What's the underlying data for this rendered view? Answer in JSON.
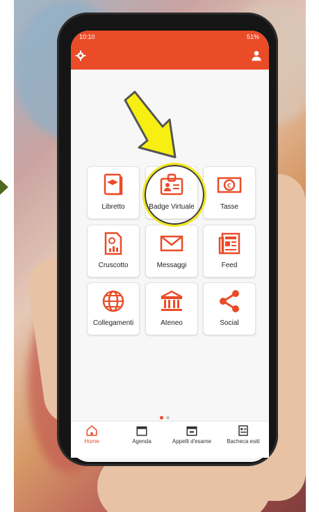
{
  "colors": {
    "accent": "#ea4c28",
    "highlight_ring": "#f2e51b",
    "arrow": "#f7ef12",
    "tile_bg": "#ffffff",
    "text": "#222222"
  },
  "statusbar": {
    "time": "10:10",
    "signal": "51%"
  },
  "tiles": [
    {
      "label": "Libretto",
      "icon": "book-icon"
    },
    {
      "label": "Badge Virtuale",
      "icon": "id-badge-icon"
    },
    {
      "label": "Tasse",
      "icon": "euro-banknote-icon"
    },
    {
      "label": "Cruscotto",
      "icon": "dashboard-chart-icon"
    },
    {
      "label": "Messaggi",
      "icon": "envelope-icon"
    },
    {
      "label": "Feed",
      "icon": "newspaper-icon"
    },
    {
      "label": "Collegamenti",
      "icon": "globe-icon"
    },
    {
      "label": "Ateneo",
      "icon": "university-building-icon"
    },
    {
      "label": "Social",
      "icon": "share-icon"
    }
  ],
  "pagination": {
    "pages": 2,
    "active_index": 0
  },
  "navbar": {
    "items": [
      {
        "label": "Home",
        "icon": "home-icon",
        "active": true
      },
      {
        "label": "Agenda",
        "icon": "calendar-icon",
        "active": false
      },
      {
        "label": "Appelli d'esame",
        "icon": "exam-calendar-icon",
        "active": false
      },
      {
        "label": "Bacheca esiti",
        "icon": "results-board-icon",
        "active": false
      }
    ]
  }
}
